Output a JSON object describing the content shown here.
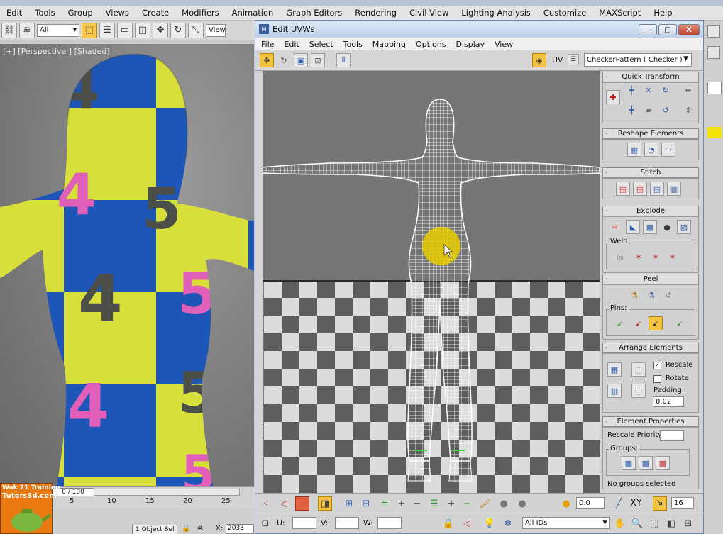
{
  "main_menu": [
    "Edit",
    "Tools",
    "Group",
    "Views",
    "Create",
    "Modifiers",
    "Animation",
    "Graph Editors",
    "Rendering",
    "Civil View",
    "Lighting Analysis",
    "Customize",
    "MAXScript",
    "Help"
  ],
  "main_toolbar": {
    "selection_filter": "All",
    "view_dropdown": "View"
  },
  "viewport": {
    "label": "[+] [Perspective ] [Shaded]"
  },
  "timeline": {
    "ticks": [
      "5",
      "10",
      "15",
      "20",
      "25"
    ],
    "slider_label": "0 / 100"
  },
  "status": {
    "selection": "1 Object Sel",
    "x_value": "2033"
  },
  "watermark": {
    "line1": "Wak 21 Training",
    "line2": "Tutors3d.com"
  },
  "uvw": {
    "title": "Edit UVWs",
    "min_symbol": "—",
    "max_symbol": "□",
    "close_symbol": "X",
    "menu": [
      "File",
      "Edit",
      "Select",
      "Tools",
      "Mapping",
      "Options",
      "Display",
      "View"
    ],
    "uv_label": "UV",
    "checker_pattern": "CheckerPattern  ( Checker )"
  },
  "rollouts": {
    "quick_transform": "Quick Transform",
    "reshape_elements": "Reshape Elements",
    "stitch": "Stitch",
    "explode": "Explode",
    "weld": "Weld",
    "peel": "Peel",
    "pins": "Pins:",
    "arrange_elements": "Arrange Elements",
    "rescale": "Rescale",
    "rotate": "Rotate",
    "padding_label": "Padding:",
    "padding_value": "0.02",
    "element_properties": "Element Properties",
    "rescale_priority": "Rescale Priority:",
    "groups_label": "Groups:",
    "no_groups": "No groups selected"
  },
  "uvw_bottom": {
    "spinner_value": "0.0",
    "xy_label": "XY",
    "count_value": "16",
    "u_label": "U:",
    "v_label": "V:",
    "w_label": "W:",
    "ids_dropdown": "All IDs"
  },
  "colors": {
    "checker_yellow": "#d9df3a",
    "checker_blue": "#1e56b8",
    "highlight": "#f3c341",
    "title_blue": "#bdd1e9"
  }
}
